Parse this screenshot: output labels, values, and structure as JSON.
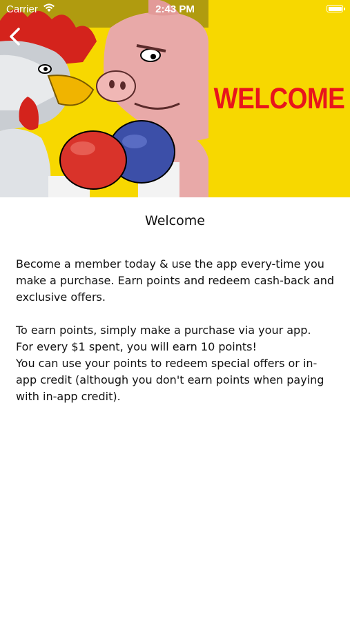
{
  "status_bar": {
    "carrier": "Carrier",
    "time": "2:43 PM"
  },
  "nav": {
    "back_icon": "chevron-left-icon"
  },
  "hero": {
    "banner_text": "WELCOME",
    "background_color": "#f7d800",
    "text_color": "#e8141c"
  },
  "page": {
    "title": "Welcome",
    "paragraph1": "Become a member today & use the app every-time you make a purchase. Earn points and redeem cash-back and exclusive offers.",
    "paragraph2_lines": [
      "To earn points, simply make a purchase via your app.",
      "For every $1 spent, you will earn 10 points!",
      "You can use your points to redeem special offers or in-app credit (although you don't earn points when paying with in-app credit)."
    ]
  }
}
